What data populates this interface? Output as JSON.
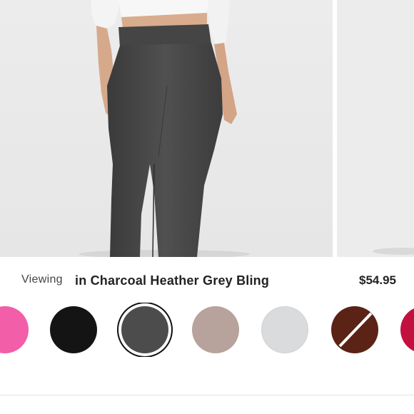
{
  "gallery": {
    "slides": [
      {
        "name": "model-wearing-charcoal-pants"
      },
      {
        "name": "next-product-image-partial"
      }
    ]
  },
  "selection": {
    "viewing_label": "Viewing",
    "color_name": "in Charcoal Heather Grey Bling",
    "price": "$54.95"
  },
  "swatches": [
    {
      "name": "swatch-pink",
      "color": "#f25ea8",
      "selected": false
    },
    {
      "name": "swatch-black",
      "color": "#141414",
      "selected": false
    },
    {
      "name": "swatch-charcoal-heather-grey",
      "color": "#4c4c4c",
      "selected": true
    },
    {
      "name": "swatch-taupe-heather",
      "color": "#b7a29c",
      "selected": false
    },
    {
      "name": "swatch-light-heather-grey",
      "color": "#d9dbdc",
      "selected": false
    },
    {
      "name": "swatch-brown-unavailable",
      "color": "#5a2316",
      "selected": false,
      "unavailable": true
    },
    {
      "name": "swatch-red",
      "color": "#c2103f",
      "selected": false
    }
  ]
}
